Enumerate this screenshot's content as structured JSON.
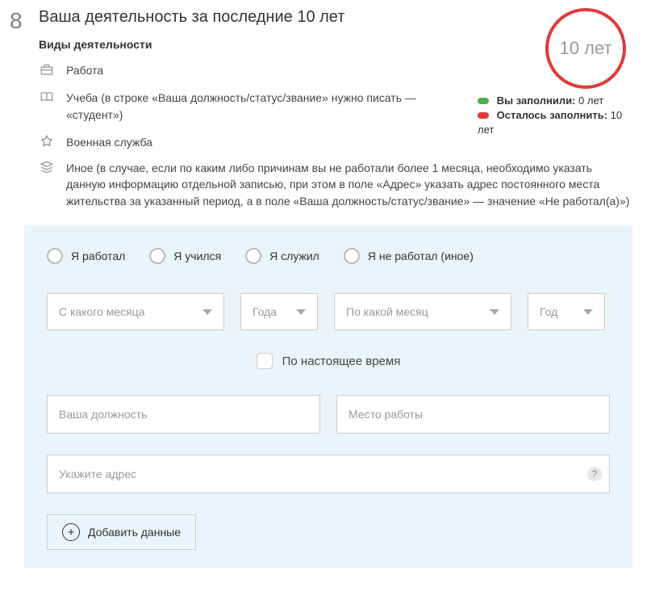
{
  "step": "8",
  "title": "Ваша деятельность за последние 10 лет",
  "subtitle": "Виды деятельности",
  "ring_label": "10 лет",
  "status": {
    "filled_label": "Вы заполнили:",
    "filled_value": "0 лет",
    "remain_label": "Осталось заполнить:",
    "remain_value": "10 лет"
  },
  "activities": [
    {
      "icon": "briefcase-icon",
      "text": "Работа"
    },
    {
      "icon": "book-icon",
      "text": "Учеба (в строке «Ваша должность/статус/звание» нужно писать — «студент»)"
    },
    {
      "icon": "star-icon",
      "text": "Военная служба"
    },
    {
      "icon": "layers-icon",
      "text": "Иное (в случае, если по каким либо причинам вы не работали более 1 месяца, необходимо указать данную информацию отдельной записью, при этом в поле «Адрес» указать адрес постоянного места жительства за указанный период, а в поле «Ваша должность/статус/звание» — значение «Не работал(а)»)"
    }
  ],
  "radios": [
    {
      "label": "Я работал"
    },
    {
      "label": "Я учился"
    },
    {
      "label": "Я служил"
    },
    {
      "label": "Я не работал (иное)"
    }
  ],
  "selects": {
    "from_month": "С какого месяца",
    "from_year": "Года",
    "to_month": "По какой месяц",
    "to_year": "Год"
  },
  "checkbox_label": "По настоящее время",
  "inputs": {
    "position": "Ваша должность",
    "workplace": "Место работы",
    "address": "Укажите адрес"
  },
  "add_button": "Добавить данные",
  "help_char": "?"
}
